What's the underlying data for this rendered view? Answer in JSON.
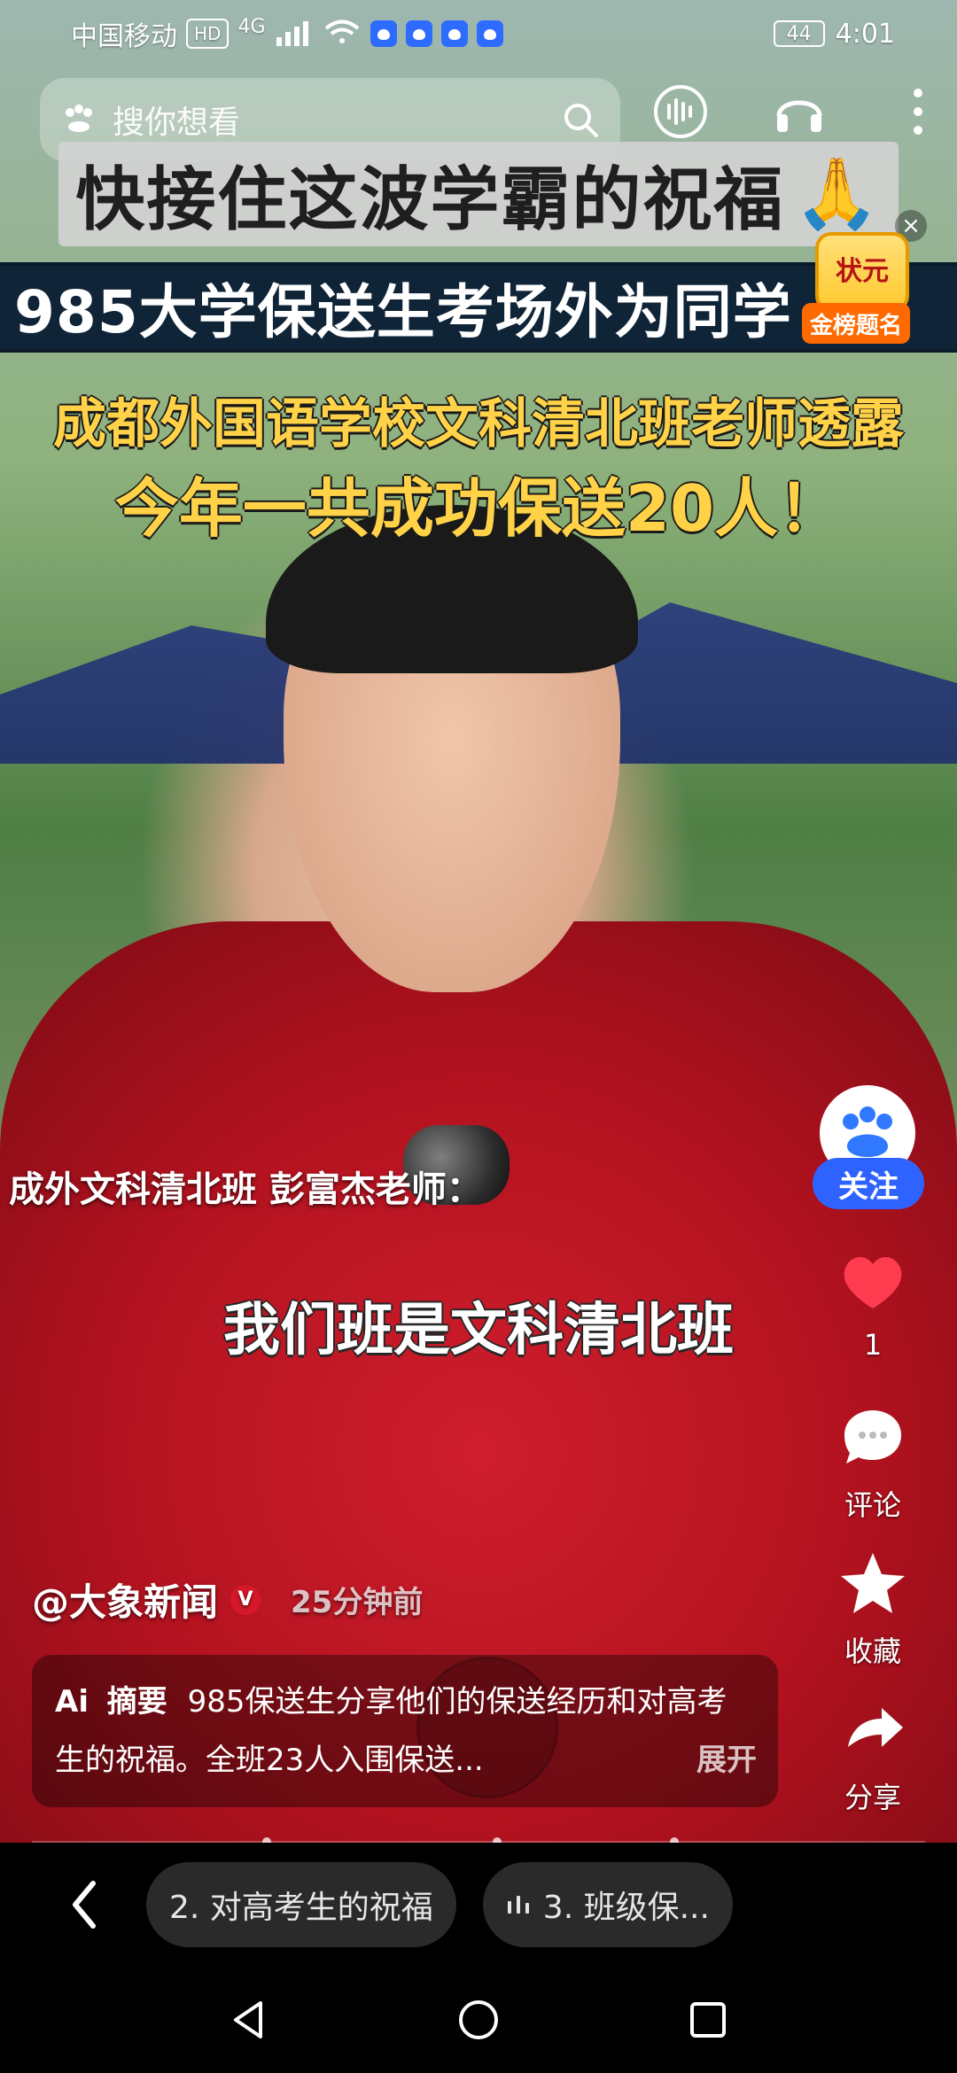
{
  "status_bar": {
    "carrier": "中国移动",
    "hd": "HD",
    "network": "4G",
    "battery": "44",
    "time": "4:01"
  },
  "search": {
    "placeholder": "搜你想看"
  },
  "video": {
    "title_band": "快接住这波学霸的祝福",
    "subtitle_band": "985大学保送生考场外为同学",
    "headline_line1": "成都外国语学校文科清北班老师透露",
    "headline_line2": "今年一共成功保送20人！",
    "speaker_label": "成外文科清北班 彭富杰老师：",
    "caption_quote": "我们班是文科清北班"
  },
  "badge": {
    "top_text": "状元",
    "bottom_text": "金榜题名"
  },
  "rail": {
    "follow_label": "关注",
    "like_count": "1",
    "comment_label": "评论",
    "favorite_label": "收藏",
    "share_label": "分享"
  },
  "author": {
    "name": "@大象新闻",
    "verified": "V",
    "time": "25分钟前"
  },
  "summary": {
    "ai_label": "Ai",
    "tag": "摘要",
    "text": "985保送生分享他们的保送经历和对高考生的祝福。全班23人入围保送...",
    "expand": "展开"
  },
  "chapters": [
    {
      "label": "2. 对高考生的祝福"
    },
    {
      "label": "3. 班级保..."
    }
  ],
  "colors": {
    "accent_blue": "#2f63ff",
    "gold": "#ffd248",
    "like_red": "#ff3b4f"
  }
}
